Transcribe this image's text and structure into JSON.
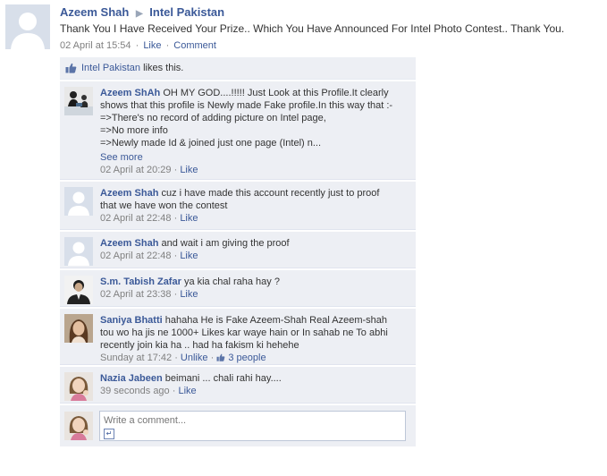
{
  "post": {
    "author": "Azeem Shah",
    "target": "Intel Pakistan",
    "text": "Thank You I Have Received Your Prize.. Which You Have Announced For Intel Photo Contest.. Thank You.",
    "time": "02 April at 15:54",
    "like_label": "Like",
    "comment_label": "Comment"
  },
  "likes": {
    "liker": "Intel Pakistan",
    "suffix": " likes this."
  },
  "comments": [
    {
      "author": "Azeem ShAh",
      "lines": [
        "OH MY GOD....!!!!! Just Look at this Profile.It clearly",
        "shows that this profile is Newly made Fake profile.In this way that :-",
        "=>There's no record of adding picture on Intel page,",
        "=>No more info",
        "=>Newly made Id & joined just one page (Intel) n..."
      ],
      "see_more": "See more",
      "time": "02 April at 20:29",
      "like_label": "Like"
    },
    {
      "author": "Azeem Shah",
      "lines": [
        "cuz i have made this account recently just to proof",
        "that we have won the contest"
      ],
      "time": "02 April at 22:48",
      "like_label": "Like"
    },
    {
      "author": "Azeem Shah",
      "lines": [
        "and wait i am giving the proof"
      ],
      "time": "02 April at 22:48",
      "like_label": "Like"
    },
    {
      "author": "S.m. Tabish Zafar",
      "lines": [
        "ya kia chal raha hay ?"
      ],
      "time": "02 April at 23:38",
      "like_label": "Like"
    },
    {
      "author": "Saniya Bhatti",
      "lines": [
        "hahaha He is Fake Azeem-Shah Real Azeem-shah",
        "tou wo ha jis ne 1000+ Likes kar waye hain or In sahab ne To abhi",
        "recently join kia ha .. had ha fakism ki hehehe"
      ],
      "time": "Sunday at 17:42",
      "like_label": "Unlike",
      "likes_count": "3 people"
    },
    {
      "author": "Nazia Jabeen",
      "lines": [
        "beimani ... chali rahi hay...."
      ],
      "time": "39 seconds ago",
      "like_label": "Like"
    }
  ],
  "reply": {
    "placeholder": "Write a comment..."
  },
  "colors": {
    "link": "#3b5998",
    "feedback_bg": "#edeff4",
    "meta": "#808080"
  }
}
